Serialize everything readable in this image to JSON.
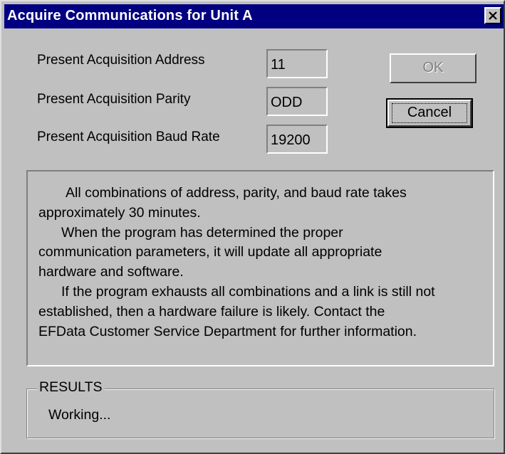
{
  "window": {
    "title": "Acquire Communications for Unit A"
  },
  "fields": [
    {
      "label": "Present Acquisition Address",
      "value": "11"
    },
    {
      "label": "Present Acquisition Parity",
      "value": "ODD"
    },
    {
      "label": "Present Acquisition Baud Rate",
      "value": "19200"
    }
  ],
  "buttons": {
    "ok": "OK",
    "cancel": "Cancel"
  },
  "info": {
    "lines": [
      "All combinations of address, parity, and baud rate takes",
      "approximately 30 minutes.",
      "When the program has determined the proper",
      "communication parameters, it will update all appropriate",
      "hardware and software.",
      "If the program exhausts all combinations and a link is still not",
      "established, then a hardware failure is likely. Contact the",
      "EFData Customer Service Department for further information."
    ]
  },
  "results": {
    "label": "RESULTS",
    "text": "Working..."
  },
  "icons": {
    "close": "close-icon"
  },
  "colors": {
    "titlebar": "#000080",
    "face": "#c0c0c0",
    "disabled_text": "#808080"
  }
}
